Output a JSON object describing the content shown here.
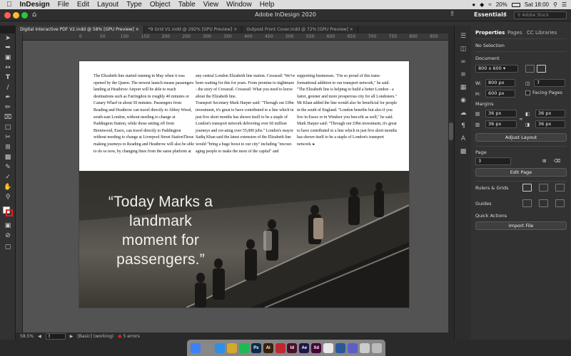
{
  "menubar": {
    "app_name": "InDesign",
    "items": [
      "File",
      "Edit",
      "Layout",
      "Type",
      "Object",
      "Table",
      "View",
      "Window",
      "Help"
    ],
    "battery": "20%",
    "clock": "Sat 18:00"
  },
  "window": {
    "title": "Adobe InDesign 2020",
    "workspace": "Essentials",
    "search_placeholder": "Adobe Stock"
  },
  "tabs": [
    {
      "label": "Digital Interactive PDF V2.indd @ 58% [GPU Preview]",
      "active": true
    },
    {
      "label": "*9 Grid V1.indd @ 292% [GPU Preview]",
      "active": false
    },
    {
      "label": "Outpost Front Cover.indd @ 72% [GPU Preview]",
      "active": false
    }
  ],
  "ruler": {
    "labels": [
      "0",
      "50",
      "100",
      "150",
      "200",
      "250",
      "300",
      "350",
      "400",
      "450",
      "500",
      "550",
      "600",
      "650",
      "700",
      "750",
      "800",
      "850"
    ]
  },
  "article": {
    "col1": "The Elizabeth line started running in May when it was opened by the Queen. The newest launch means passengers landing at Heathrow Airport will be able to reach destinations such as Farringdon in roughly 40 minutes or Canary Wharf in about 50 minutes. Passengers from Reading and Heathrow can travel directly to Abbey Wood, south-east London, without needing to change at Paddington Station, while those setting off from Brentwood, Essex, can travel directly to Paddington without needing to change at Liverpool Street StationThose making journeys to Reading and Heathrow will also be able to do so now, by changing lines from the same platform at",
    "col2": "any central London Elizabeth line station. Crossrail: 'We've been waiting for this for years. From promise to nightmare - the story of Crossrail. Crossrail: What you need to know about the Elizabeth line.\n      Transport Secretary Mark Harper said: \"Through our £9bn investment, it's great to have contributed to a line which in just five short months has shown itself to be a staple of London's transport network delivering over 60 million journeys and cre-ating over 55,000 jobs.\" London's mayor Sadiq Khan said the latest extension of the Elizabeth line would \"bring a huge boost to our city\" including \"encour-aging people to make the most of the capital\" and",
    "col3": "supporting businesses. \"I'm so proud of this trans-formational addition to our transport network,\" he said. \"The Elizabeth line is helping to build a better London - a fairer, greener and more prosperous city for all Londoners.\"\n      Mr Khan added the line would also be beneficial for people in the south of England. \"London benefits but also if you live in Essex or in Windsor you ben-efit as well,\" he said. Mark Harper said: \"Through our £9bn investment, it's great to have contributed to a line which in just five short months has shown itself to be a staple of London's transport network. ▸",
    "quote": "“Today Marks a landmark moment for passengers.”"
  },
  "statusbar": {
    "zoom": "58.5%",
    "page": "3",
    "style": "[Basic] (working)",
    "errors": "5 errors"
  },
  "properties": {
    "tabs": [
      "Properties",
      "Pages",
      "CC Libraries"
    ],
    "selection": "No Selection",
    "document_label": "Document",
    "preset": "800 x 600",
    "width_label": "W:",
    "width": "800 px",
    "height_label": "H:",
    "height": "600 px",
    "pages_count": "7",
    "facing_pages": "Facing Pages",
    "margins_label": "Margins",
    "margin_top": "36 px",
    "margin_bottom": "36 px",
    "margin_left": "36 px",
    "margin_right": "36 px",
    "adjust_layout": "Adjust Layout",
    "page_label": "Page",
    "page_value": "3",
    "edit_page": "Edit Page",
    "rulers_grids": "Rulers & Grids",
    "guides": "Guides",
    "quick_actions": "Quick Actions",
    "import_file": "Import File"
  },
  "dock": {
    "apps": [
      {
        "icon": "finder-icon",
        "label": "",
        "color": "#3b82f6"
      },
      {
        "icon": "launchpad-icon",
        "label": "",
        "color": "#888888"
      },
      {
        "icon": "safari-icon",
        "label": "",
        "color": "#2f8fe8"
      },
      {
        "icon": "photos-icon",
        "label": "",
        "color": "#d4a82a"
      },
      {
        "icon": "spotify-icon",
        "label": "",
        "color": "#1db954"
      },
      {
        "icon": "photoshop-icon",
        "label": "Ps",
        "color": "#0c2a4a"
      },
      {
        "icon": "illustrator-icon",
        "label": "Ai",
        "color": "#3a1f0b"
      },
      {
        "icon": "acrobat-icon",
        "label": "",
        "color": "#c0262d"
      },
      {
        "icon": "indesign-icon",
        "label": "Id",
        "color": "#4a0e2a"
      },
      {
        "icon": "aftereffects-icon",
        "label": "Ae",
        "color": "#1d1448"
      },
      {
        "icon": "xd-icon",
        "label": "Xd",
        "color": "#470137"
      },
      {
        "icon": "chrome-icon",
        "label": "",
        "color": "#e8e8e8"
      },
      {
        "icon": "word-icon",
        "label": "",
        "color": "#2b5797"
      },
      {
        "icon": "teams-icon",
        "label": "",
        "color": "#5b5fc7"
      },
      {
        "icon": "files-icon",
        "label": "",
        "color": "#cccccc"
      },
      {
        "icon": "trash-icon",
        "label": "",
        "color": "#bbbbbb"
      }
    ]
  }
}
